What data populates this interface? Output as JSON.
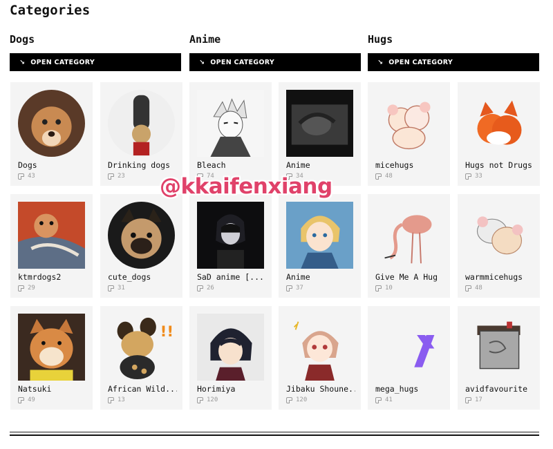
{
  "page_title": "Categories",
  "watermark": "@kkaifenxiang",
  "open_label": "OPEN CATEGORY",
  "sections": [
    {
      "title": "Dogs"
    },
    {
      "title": "Anime"
    },
    {
      "title": "Hugs"
    }
  ],
  "cards": [
    {
      "name": "Dogs",
      "count": "43"
    },
    {
      "name": "Drinking dogs",
      "count": "23"
    },
    {
      "name": "Bleach",
      "count": "74"
    },
    {
      "name": "Anime",
      "count": "34"
    },
    {
      "name": "micehugs",
      "count": "48"
    },
    {
      "name": "Hugs not Drugs",
      "count": "33"
    },
    {
      "name": "ktmrdogs2",
      "count": "29"
    },
    {
      "name": "cute_dogs",
      "count": "31"
    },
    {
      "name": "SaD anime [...",
      "count": "26"
    },
    {
      "name": "Anime",
      "count": "37"
    },
    {
      "name": "Give Me A Hug",
      "count": "10"
    },
    {
      "name": "warmmicehugs",
      "count": "48"
    },
    {
      "name": "Natsuki",
      "count": "49"
    },
    {
      "name": "African Wild...",
      "count": "13"
    },
    {
      "name": "Horimiya",
      "count": "120"
    },
    {
      "name": "Jibaku Shoune...",
      "count": "120"
    },
    {
      "name": "mega_hugs",
      "count": "41"
    },
    {
      "name": "avidfavourite",
      "count": "17"
    }
  ]
}
